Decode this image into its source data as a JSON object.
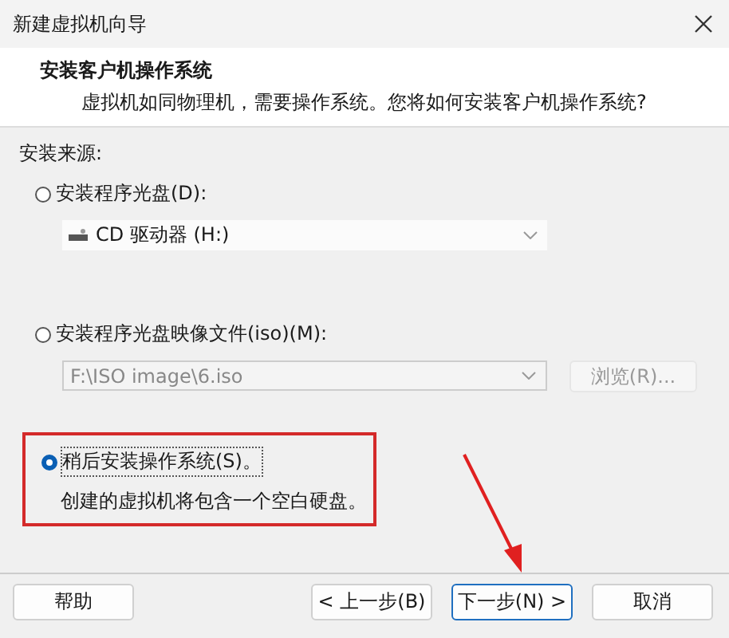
{
  "window": {
    "title": "新建虚拟机向导"
  },
  "header": {
    "title": "安装客户机操作系统",
    "subtitle": "虚拟机如同物理机，需要操作系统。您将如何安装客户机操作系统?"
  },
  "source_label": "安装来源:",
  "options": [
    {
      "kind": "drive",
      "label": "安装程序光盘(D):",
      "selected": false,
      "field": {
        "value": "CD 驱动器 (H:)",
        "disabled": false
      }
    },
    {
      "kind": "iso",
      "label": "安装程序光盘映像文件(iso)(M):",
      "selected": false,
      "field": {
        "value": "F:\\ISO image\\6.iso",
        "disabled": true
      },
      "browse": {
        "label": "浏览(R)...",
        "disabled": true
      }
    },
    {
      "kind": "later",
      "label": "稍后安装操作系统(S)。",
      "selected": true,
      "description": "创建的虚拟机将包含一个空白硬盘。"
    }
  ],
  "buttons": [
    {
      "label": "帮助",
      "default": false
    },
    {
      "label": "< 上一步(B)",
      "default": false
    },
    {
      "label": "下一步(N) >",
      "default": true
    },
    {
      "label": "取消",
      "default": false
    }
  ]
}
